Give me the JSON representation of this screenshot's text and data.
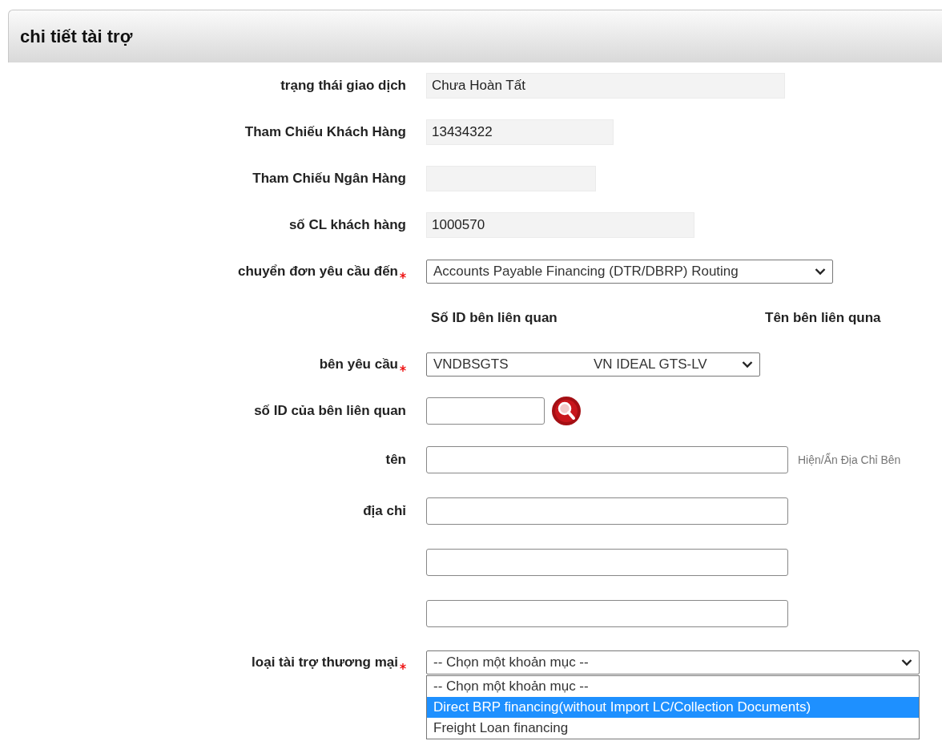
{
  "panel": {
    "title": "chi tiết tài trợ"
  },
  "rows": [
    {
      "kind": "readonly",
      "label": "trạng thái giao dịch",
      "value": "Chưa Hoàn Tất",
      "required": false
    },
    {
      "kind": "readonly",
      "label": "Tham Chiếu Khách Hàng",
      "value": "13434322",
      "required": false
    },
    {
      "kind": "readonly",
      "label": "Tham Chiếu Ngân Hàng",
      "required": false
    },
    {
      "kind": "readonly",
      "label": "số CL khách hàng",
      "value": "1000570",
      "required": false
    },
    {
      "kind": "select",
      "label": "chuyển đơn yêu cầu đến",
      "value": "Accounts Payable Financing (DTR/DBRP) Routing",
      "required": true
    },
    {
      "kind": "headings",
      "columns": [
        "Số ID bên liên quan",
        "Tên bên liên quna"
      ]
    },
    {
      "kind": "party_select",
      "label": "bên yêu cầu",
      "values": [
        "VNDBSGTS",
        "VN IDEAL GTS-LV"
      ],
      "required": true
    },
    {
      "kind": "search",
      "label": "số ID của bên liên quan",
      "required": false
    },
    {
      "kind": "text",
      "label": "tên",
      "hint": "Hiện/Ẩn Địa Chỉ Bên",
      "required": false
    },
    {
      "kind": "text",
      "label": "địa chỉ",
      "required": false
    },
    {
      "kind": "text"
    },
    {
      "kind": "text"
    },
    {
      "kind": "open_select",
      "label": "loại tài trợ thương mại",
      "value": "-- Chọn một khoản mục --",
      "required": true,
      "options": [
        {
          "label": "-- Chọn một khoản mục --",
          "highlighted": false
        },
        {
          "label": "Direct BRP financing(without Import LC/Collection Documents)",
          "highlighted": true
        },
        {
          "label": "Freight Loan financing",
          "highlighted": false
        }
      ]
    }
  ]
}
